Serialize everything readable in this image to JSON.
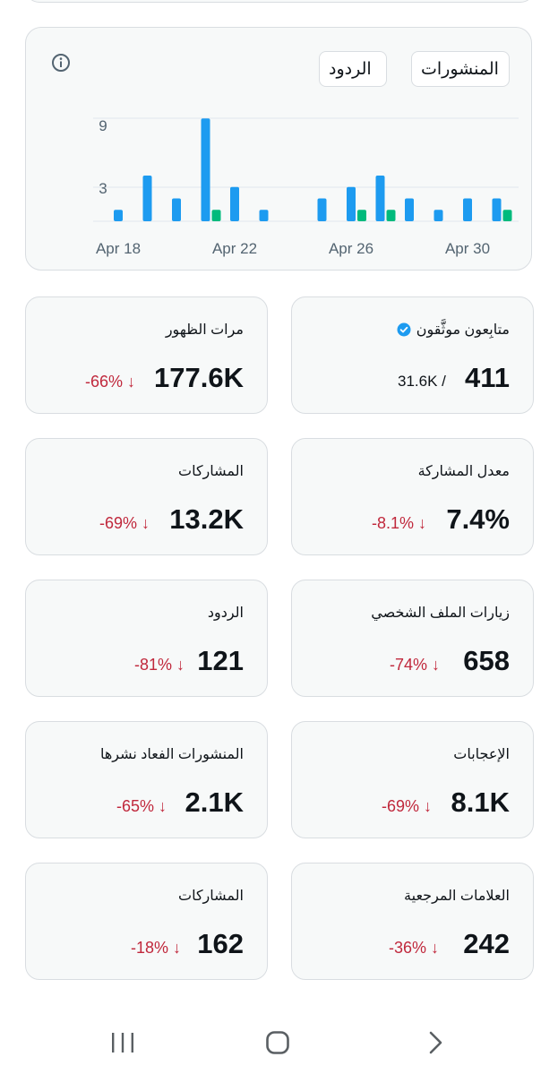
{
  "chart": {
    "legend": [
      {
        "label": "المنشورات",
        "color": "#1d9bf0"
      },
      {
        "label": "الردود",
        "color": "#00ba7c"
      }
    ],
    "y_ticks": [
      "9",
      "3"
    ],
    "x_ticks": [
      "Apr 18",
      "Apr 22",
      "Apr 26",
      "Apr 30"
    ]
  },
  "chart_data": {
    "type": "bar",
    "x": [
      "Apr 18",
      "Apr 19",
      "Apr 20",
      "Apr 21",
      "Apr 22",
      "Apr 23",
      "Apr 24",
      "Apr 25",
      "Apr 26",
      "Apr 27",
      "Apr 28",
      "Apr 29",
      "Apr 30",
      "May 1"
    ],
    "series": [
      {
        "name": "المنشورات",
        "color": "#1d9bf0",
        "values": [
          1,
          4,
          2,
          9,
          3,
          1,
          0,
          2,
          3,
          4,
          2,
          1,
          2,
          2
        ]
      },
      {
        "name": "الردود",
        "color": "#00ba7c",
        "values": [
          0,
          0,
          0,
          1,
          0,
          0,
          0,
          0,
          1,
          1,
          0,
          0,
          0,
          1
        ]
      }
    ],
    "y_ticks": [
      9,
      3
    ],
    "ylim": [
      0,
      10
    ],
    "grid": true,
    "legend_position": "top-right"
  },
  "metrics": {
    "verified_followers": {
      "label": "متابِعون موثَّقون",
      "value": "411",
      "sub": "31.6K /"
    },
    "impressions": {
      "label": "مرات الظهور",
      "value": "177.6K",
      "change": "-66% ↓"
    },
    "engagement_rate": {
      "label": "معدل المشاركة",
      "value": "7.4%",
      "change": "-8.1% ↓"
    },
    "engagements": {
      "label": "المشاركات",
      "value": "13.2K",
      "change": "-69% ↓"
    },
    "profile_visits": {
      "label": "زيارات الملف الشخصي",
      "value": "658",
      "change": "-74% ↓"
    },
    "replies": {
      "label": "الردود",
      "value": "121",
      "change": "-81% ↓"
    },
    "likes": {
      "label": "الإعجابات",
      "value": "8.1K",
      "change": "-69% ↓"
    },
    "reposts": {
      "label": "المنشورات الفعاد نشرها",
      "value": "2.1K",
      "change": "-65% ↓"
    },
    "bookmarks": {
      "label": "العلامات المرجعية",
      "value": "242",
      "change": "-36% ↓"
    },
    "shares": {
      "label": "المشاركات",
      "value": "162",
      "change": "-18% ↓"
    }
  },
  "icons": {
    "info": "info-icon",
    "verified": "verified-badge-icon",
    "nav_recents": "recents-icon",
    "nav_home": "home-icon",
    "nav_back": "back-icon"
  }
}
